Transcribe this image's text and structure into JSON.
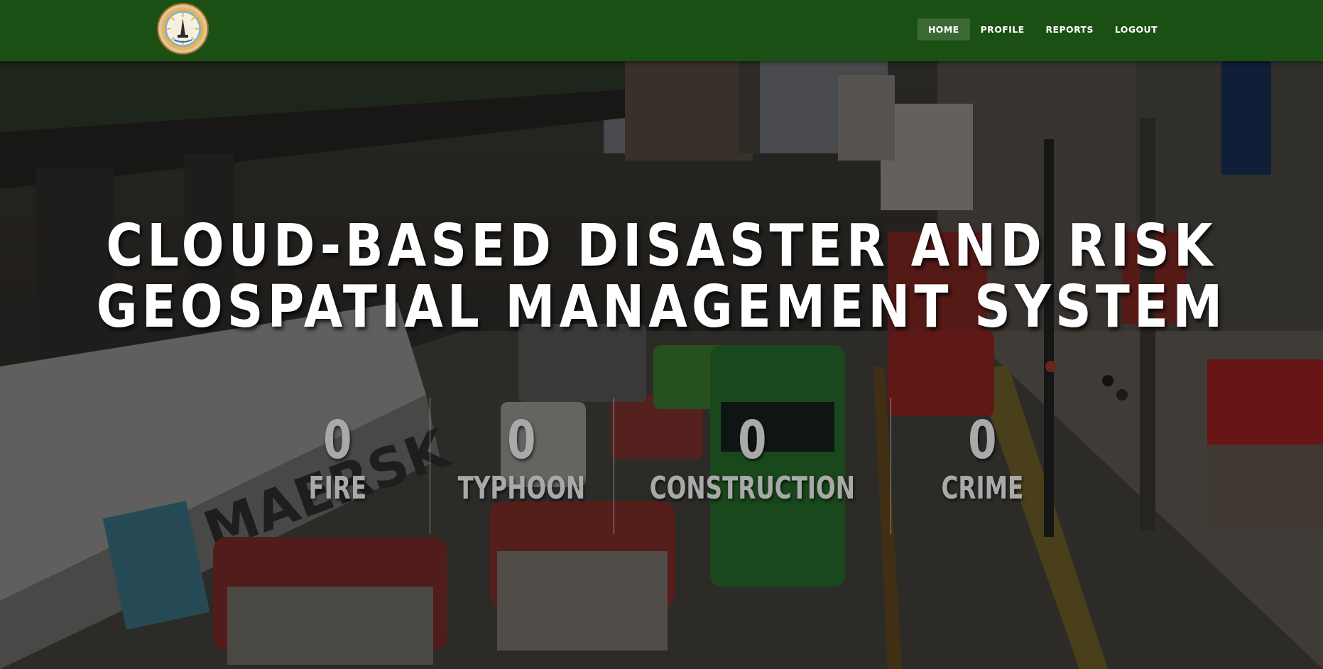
{
  "navbar": {
    "logo_icon": "seal-logo",
    "background": "#1b5014",
    "items": [
      {
        "label": "HOME",
        "active": true
      },
      {
        "label": "PROFILE",
        "active": false
      },
      {
        "label": "REPORTS",
        "active": false
      },
      {
        "label": "LOGOUT",
        "active": false
      }
    ]
  },
  "hero": {
    "title_line1": "CLOUD-BASED DISASTER AND RISK",
    "title_line2": "GEOSPATIAL MANAGEMENT SYSTEM",
    "background_image": "city-street-traffic-photo",
    "counters": [
      {
        "value": "0",
        "label": "FIRE"
      },
      {
        "value": "0",
        "label": "TYPHOON"
      },
      {
        "value": "0",
        "label": "CONSTRUCTION"
      },
      {
        "value": "0",
        "label": "CRIME"
      }
    ]
  }
}
